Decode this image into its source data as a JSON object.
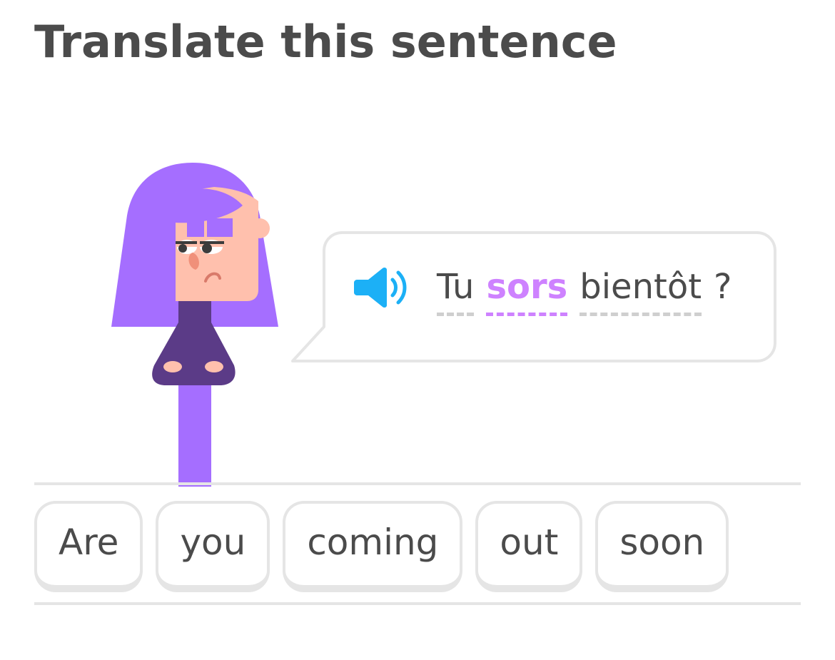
{
  "prompt": {
    "title": "Translate this sentence"
  },
  "speech": {
    "audio_icon": "speaker-icon",
    "words": [
      {
        "text": "Tu",
        "new": false
      },
      {
        "text": "sors",
        "new": true
      },
      {
        "text": "bientôt",
        "new": false
      },
      {
        "text": "?",
        "new": false
      }
    ]
  },
  "word_bank": {
    "tiles": [
      {
        "text": "Are"
      },
      {
        "text": "you"
      },
      {
        "text": "coming"
      },
      {
        "text": "out"
      },
      {
        "text": "soon"
      }
    ]
  },
  "colors": {
    "text": "#4b4b4b",
    "highlight": "#ce82ff",
    "border": "#e5e5e5",
    "audio": "#1cb0f6",
    "hair": "#a56eff",
    "sweater": "#5b3b87"
  }
}
